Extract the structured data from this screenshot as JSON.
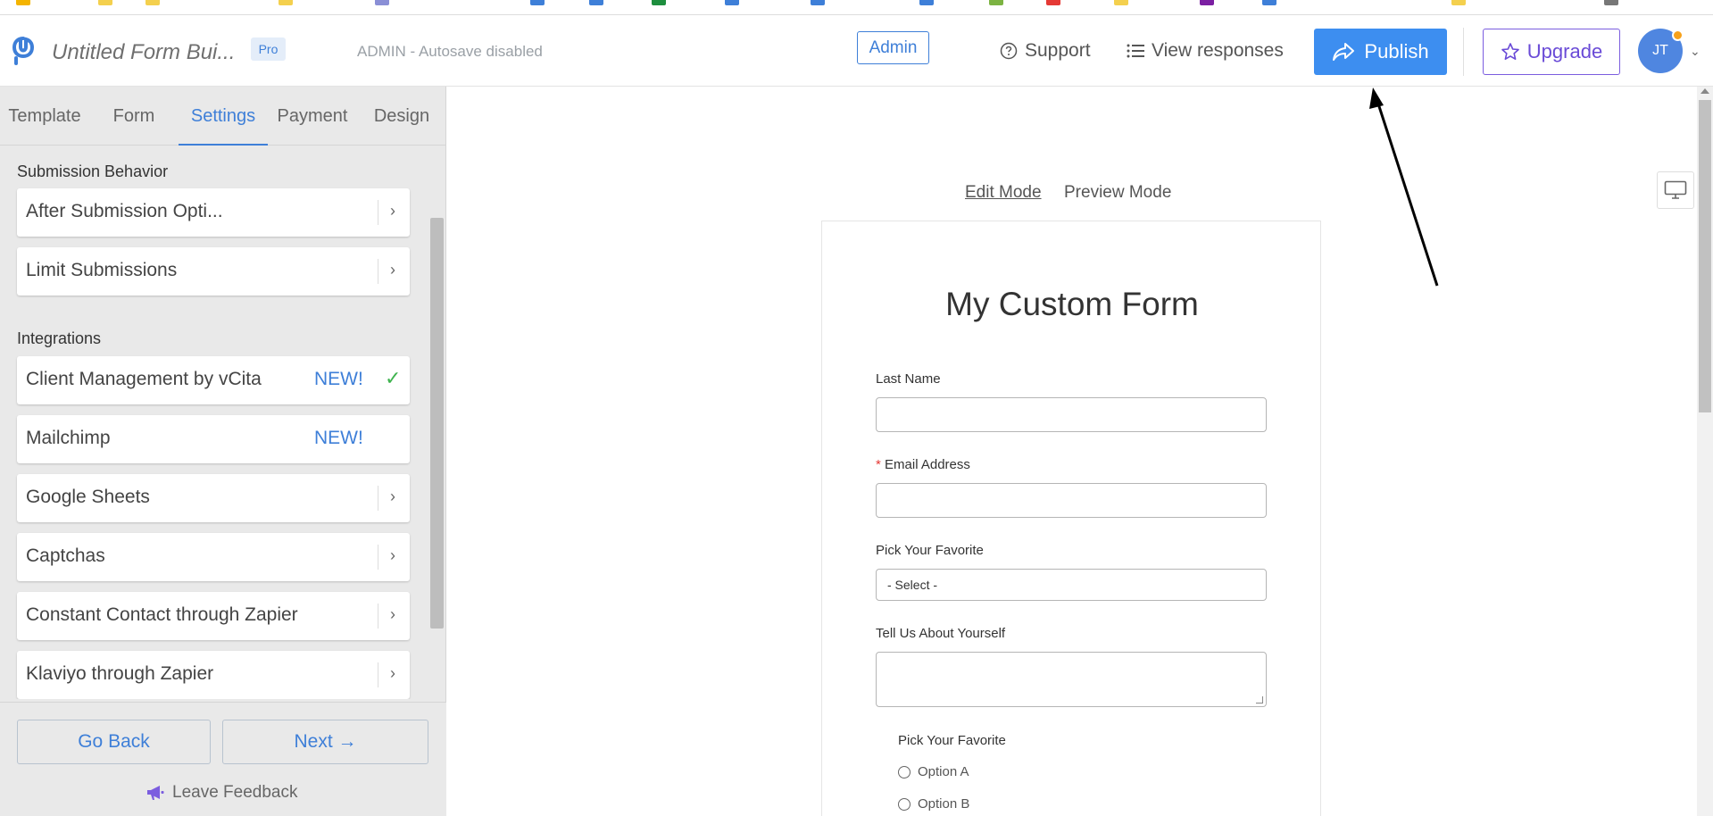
{
  "header": {
    "form_title": "Untitled Form Bui...",
    "pro_badge": "Pro",
    "admin_status": "ADMIN - Autosave disabled",
    "admin_button": "Admin",
    "support_label": "Support",
    "view_responses_label": "View responses",
    "publish_label": "Publish",
    "upgrade_label": "Upgrade",
    "avatar_initials": "JT"
  },
  "tabs": [
    {
      "label": "Template"
    },
    {
      "label": "Form"
    },
    {
      "label": "Settings",
      "active": true
    },
    {
      "label": "Payment"
    },
    {
      "label": "Design"
    }
  ],
  "settings": {
    "submission_section": "Submission Behavior",
    "submission_items": [
      {
        "label": "After Submission Opti..."
      },
      {
        "label": "Limit Submissions"
      }
    ],
    "integrations_section": "Integrations",
    "integrations_items": [
      {
        "label": "Client Management by vCita",
        "tag": "NEW!",
        "checked": true
      },
      {
        "label": "Mailchimp",
        "tag": "NEW!"
      },
      {
        "label": "Google Sheets"
      },
      {
        "label": "Captchas"
      },
      {
        "label": "Constant Contact through Zapier"
      },
      {
        "label": "Klaviyo through Zapier"
      }
    ]
  },
  "footer": {
    "go_back": "Go Back",
    "next": "Next →",
    "feedback": "Leave Feedback"
  },
  "canvas": {
    "edit_mode": "Edit Mode",
    "preview_mode": "Preview Mode"
  },
  "form": {
    "title": "My Custom Form",
    "fields": {
      "last_name_label": "Last Name",
      "email_required_mark": "*",
      "email_label": "Email Address",
      "pick_label": "Pick Your Favorite",
      "select_value": "- Select -",
      "about_label": "Tell Us About Yourself",
      "radio_group_label": "Pick Your Favorite",
      "radio_options": [
        "Option A",
        "Option B"
      ]
    }
  },
  "colors": {
    "accent": "#3e7fd8",
    "publish_bg": "#3d8ef0",
    "upgrade": "#6a4bd7",
    "panel_bg": "#e9e9e9",
    "success_check": "#3fb34f"
  }
}
